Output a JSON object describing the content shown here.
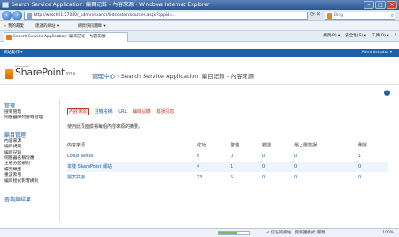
{
  "window": {
    "title": "Search Service Application: 編目記錄 - 內容來源 - Windows Internet Explorer"
  },
  "address": {
    "url": "http://wssch01:27080/_admin/search/listcontentsources.aspx?appid=...",
    "search_placeholder": "Bing"
  },
  "favorites": {
    "fav_label": "我的最愛",
    "suggested": "建議的網站 ▾",
    "gallery": "網頁快訊圖庫 ▾"
  },
  "tab": {
    "label": "Search Service Application: 編目記錄 - 內容來源"
  },
  "commandbar": {
    "page": "網頁(P) ▾",
    "safety": "安全性(S) ▾",
    "tools": "工具(O) ▾",
    "help": "?"
  },
  "ribbon": {
    "site_actions": "網站動作 ▾",
    "user": "Administrator ▾"
  },
  "header": {
    "logo_sub": "Microsoft",
    "logo": "SharePoint",
    "version": "2010",
    "crumb_root": "管理中心",
    "crumb_mid": "Search Service Application: 編目記錄 - 內容來源"
  },
  "leftnav": {
    "section1": "管理",
    "items1": [
      "搜尋管理",
      "伺服器陣列搜尋管理"
    ],
    "section2": "編目管理",
    "items2": [
      "內容來源",
      "編目規則",
      "編目記錄",
      "伺服器名稱對應",
      "主機分配規則",
      "檔案類型",
      "重設索引",
      "編目程式影響規則"
    ],
    "section3": "查詢與結果"
  },
  "subtabs": {
    "content_source": "內容來源",
    "host": "主機名稱",
    "url": "URL",
    "crawl_history": "編目記錄",
    "error_message": "錯誤訊息"
  },
  "description": "使用此頁面檢視每個內容來源的摘要。",
  "table": {
    "headers": [
      "內容來源",
      "成功",
      "警告",
      "錯誤",
      "最上層錯誤",
      "刪除"
    ],
    "rows": [
      {
        "name": "Lotus Notes",
        "success": "6",
        "warning": "0",
        "error": "0",
        "top_error": "0",
        "deleted": "1"
      },
      {
        "name": "本機 SharePoint 網站",
        "success": "4",
        "warning": "1",
        "error": "0",
        "top_error": "0",
        "deleted": "0"
      },
      {
        "name": "檔案共用",
        "success": "73",
        "warning": "5",
        "error": "0",
        "top_error": "0",
        "deleted": "0"
      }
    ]
  },
  "status": {
    "zone": "信任的網站 | 受保護模式: 關閉",
    "zoom": "100%",
    "progress": 0.6
  }
}
